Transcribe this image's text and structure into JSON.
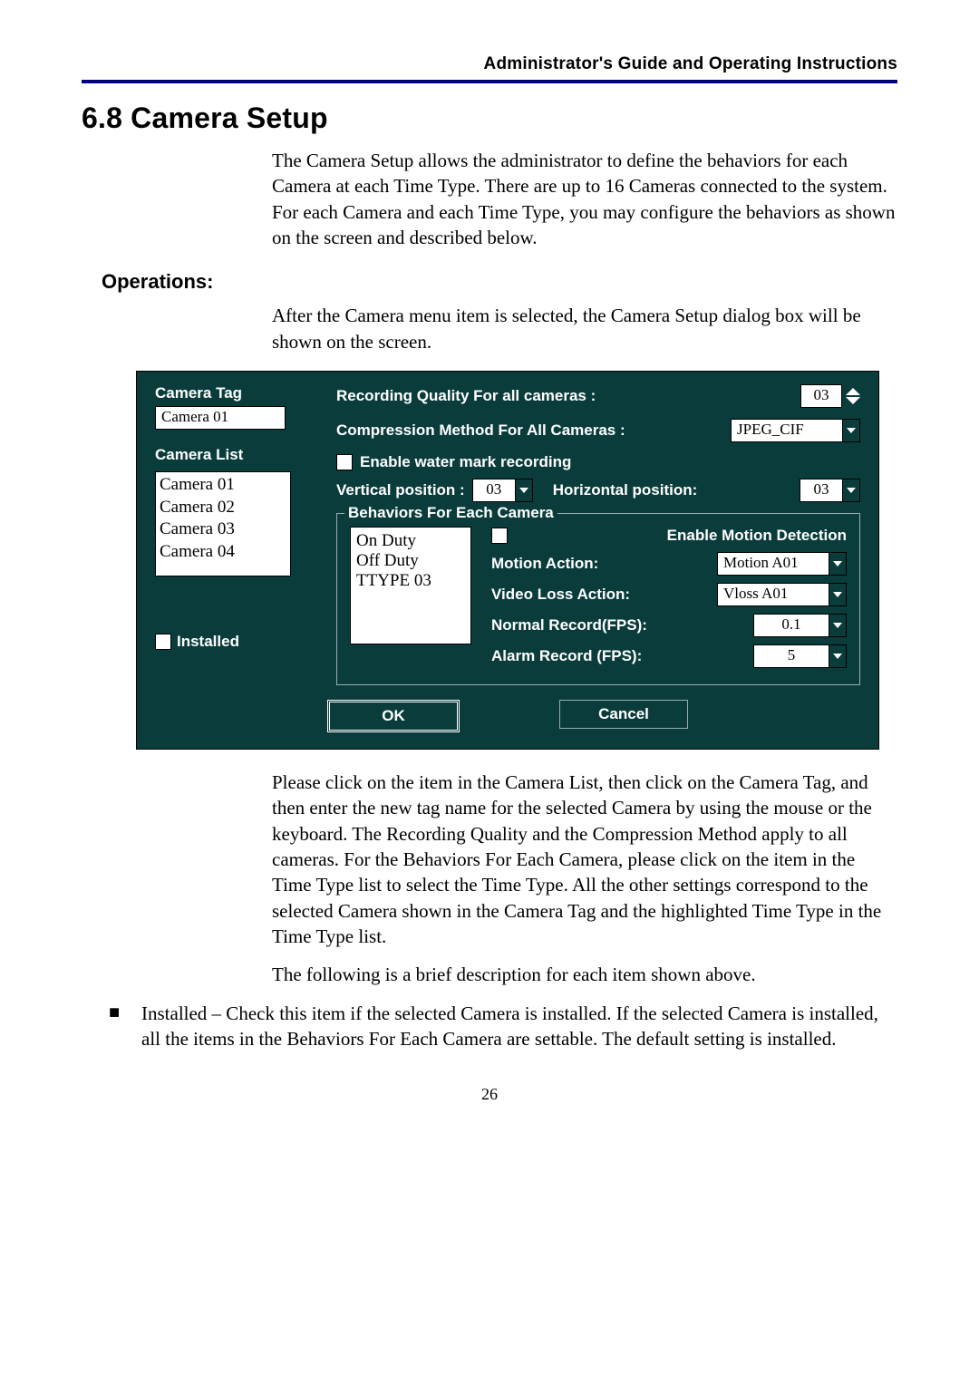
{
  "running_head": "Administrator's Guide and Operating Instructions",
  "section_title": "6.8 Camera Setup",
  "intro_para": "The Camera Setup allows the administrator to define the behaviors for each Camera at each Time Type.    There are up to 16 Cameras connected to the system.    For each Camera and each Time Type, you may configure the behaviors as shown on the screen and described below.",
  "ops_head": "Operations:",
  "ops_para": "After the Camera menu item is selected, the Camera Setup dialog box will be shown on the screen.",
  "dialog": {
    "camera_tag_label": "Camera Tag",
    "camera_tag_value": "Camera 01",
    "camera_list_label": "Camera List",
    "camera_list": [
      "Camera 01",
      "Camera 02",
      "Camera 03",
      "Camera 04"
    ],
    "installed_label": "Installed",
    "rec_quality_label": "Recording Quality For all cameras :",
    "rec_quality_value": "03",
    "comp_method_label": "Compression Method For All Cameras :",
    "comp_method_value": "JPEG_CIF",
    "enable_wm_label": "Enable water mark recording",
    "v_pos_label": "Vertical position :",
    "v_pos_value": "03",
    "h_pos_label": "Horizontal position:",
    "h_pos_value": "03",
    "behaviors_legend": "Behaviors For Each Camera",
    "time_types": [
      "On Duty",
      "Off Duty",
      "TTYPE 03"
    ],
    "enable_motion_label": "Enable Motion Detection",
    "motion_action_label": "Motion Action:",
    "motion_action_value": "Motion A01",
    "video_loss_label": "Video Loss Action:",
    "video_loss_value": "Vloss A01",
    "normal_rec_label": "Normal Record(FPS):",
    "normal_rec_value": "0.1",
    "alarm_rec_label": "Alarm Record (FPS):",
    "alarm_rec_value": "5",
    "ok_label": "OK",
    "cancel_label": "Cancel"
  },
  "post_para": "Please click on the item in the Camera List, then click on the Camera Tag, and then enter the new tag name for the selected Camera by using the mouse or the keyboard.    The Recording Quality and the Compression Method apply to all cameras.    For the Behaviors For Each Camera, please click on the item in the Time Type list to select the Time Type.    All the other settings correspond to the selected Camera shown in the Camera Tag and the highlighted Time Type in the Time Type list.",
  "following_line": "The following is a brief description for each item shown above.",
  "bullet_text": "Installed – Check this item if the selected Camera is installed.    If the selected Camera is installed, all the items in the Behaviors For Each Camera are settable.    The default setting is installed.",
  "page_num": "26"
}
